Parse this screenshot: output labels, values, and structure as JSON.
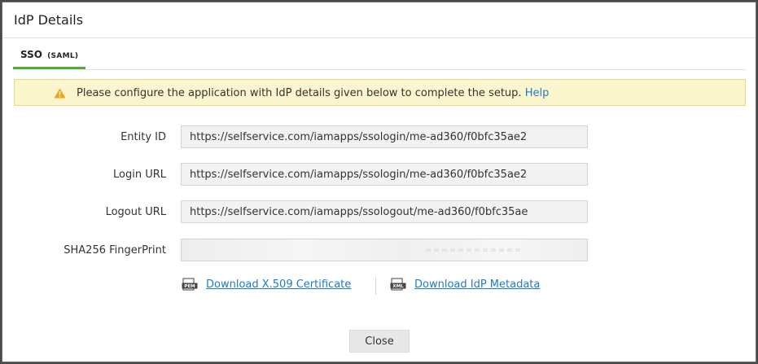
{
  "dialog": {
    "title": "IdP Details"
  },
  "tabs": [
    {
      "label": "SSO",
      "sub": "(SAML)"
    }
  ],
  "alert": {
    "message": "Please configure the application with IdP details given below to complete the setup.",
    "link": "Help"
  },
  "fields": {
    "entity_id": {
      "label": "Entity ID",
      "value": "https://selfservice.com/iamapps/ssologin/me-ad360/f0bfc35ae2"
    },
    "login_url": {
      "label": "Login URL",
      "value": "https://selfservice.com/iamapps/ssologin/me-ad360/f0bfc35ae2"
    },
    "logout_url": {
      "label": "Logout URL",
      "value": "https://selfservice.com/iamapps/ssologout/me-ad360/f0bfc35ae"
    },
    "fingerprint": {
      "label": "SHA256 FingerPrint"
    }
  },
  "downloads": {
    "certificate": {
      "icon": "PEM",
      "label": "Download X.509 Certificate"
    },
    "metadata": {
      "icon": "XML",
      "label": "Download IdP Metadata"
    }
  },
  "buttons": {
    "close": "Close"
  },
  "colors": {
    "accent_green": "#57a839",
    "link_blue": "#1f7ac7",
    "alert_bg": "#fbf5cd",
    "warning": "#e6a817"
  }
}
